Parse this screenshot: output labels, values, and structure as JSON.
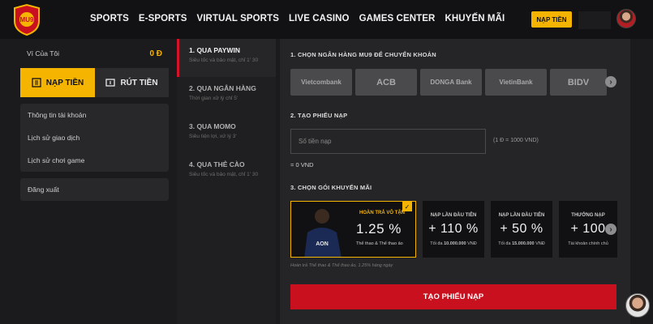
{
  "header": {
    "nav": [
      "SPORTS",
      "E-SPORTS",
      "VIRTUAL SPORTS",
      "LIVE CASINO",
      "GAMES CENTER",
      "KHUYẾN MÃI"
    ],
    "deposit_button": "NẠP TIỀN",
    "logo_icon": "mu9-shield-logo-icon",
    "avatar_icon": "user-avatar-icon"
  },
  "sidebar": {
    "wallet_label": "Ví Của Tôi",
    "wallet_amount": "0 Đ",
    "tab_deposit": "NẠP TIỀN",
    "tab_withdraw": "RÚT TIỀN",
    "menu": [
      "Thông tin tài khoản",
      "Lịch sử giao dịch",
      "Lịch sử chơi game"
    ],
    "logout": "Đăng xuất"
  },
  "methods": [
    {
      "title": "1. QUA PAYWIN",
      "sub": "Siêu tốc và bảo mật, chỉ 1' 30"
    },
    {
      "title": "2. QUA NGÂN HÀNG",
      "sub": "Thời gian xử lý chỉ 5'"
    },
    {
      "title": "3. QUA MOMO",
      "sub": "Siêu tiện lợi, xử lý 3'"
    },
    {
      "title": "4. QUA THẺ CÀO",
      "sub": "Siêu tốc và bảo mật, chỉ 1' 30"
    }
  ],
  "step1": {
    "title": "1. CHỌN NGÂN HÀNG MU9 ĐỂ CHUYỂN KHOẢN",
    "banks": [
      "Vietcombank",
      "ACB",
      "DONGA Bank",
      "VietinBank",
      "BIDV"
    ]
  },
  "step2": {
    "title": "2. TẠO PHIẾU NẠP",
    "amount_placeholder": "Số tiền nạp",
    "rate": "(1 Đ = 1000 VND)",
    "converted": "= 0 VND"
  },
  "step3": {
    "title": "3. CHỌN GÓI KHUYẾN MÃI",
    "selected": {
      "title": "HOÀN TRẢ VÔ TẬN",
      "value": "1.25 %",
      "desc": "Thể thao & Thể thao ảo"
    },
    "promos": [
      {
        "title": "NẠP LẦN ĐẦU TIÊN",
        "value": "+ 110 %",
        "desc_prefix": "Tối đa ",
        "desc_amount": "10.000.000",
        "desc_suffix": " VNĐ"
      },
      {
        "title": "NẠP LẦN ĐẦU TIÊN",
        "value": "+ 50 %",
        "desc_prefix": "Tối đa ",
        "desc_amount": "15.000.000",
        "desc_suffix": " VNĐ"
      },
      {
        "title": "THƯỞNG NẠP",
        "value": "+ 100",
        "desc": "Tài khoản chính chủ"
      }
    ],
    "note": "Hoàn trả Thể thao & Thể thao ảo, 1.25% hàng ngày"
  },
  "submit_button": "TẠO PHIẾU NẠP",
  "colors": {
    "accent": "#f5b400",
    "primary_red": "#c9101e",
    "background": "#1b1b1d"
  }
}
